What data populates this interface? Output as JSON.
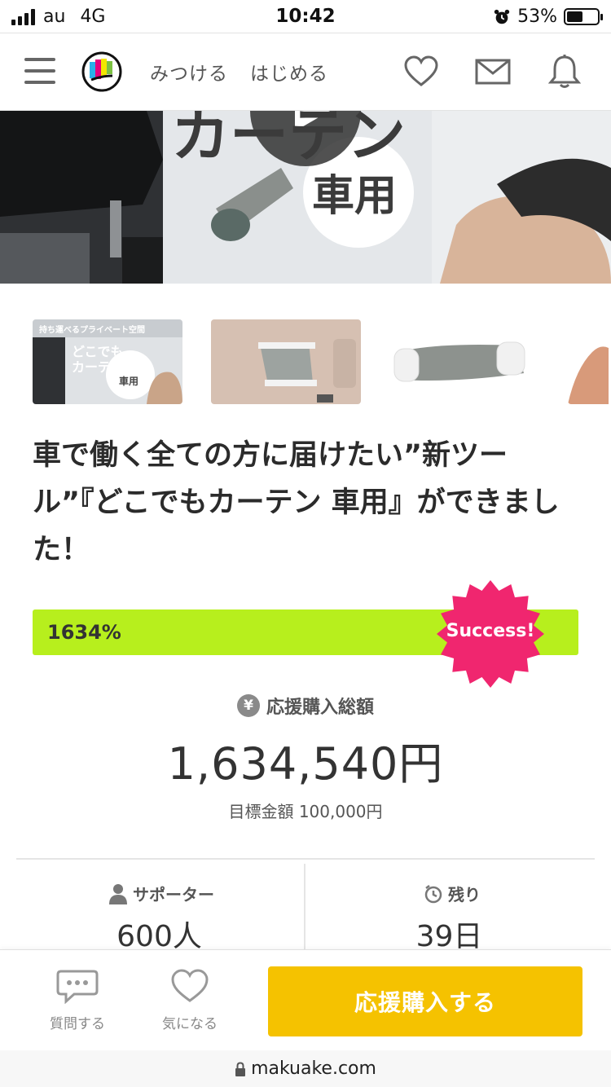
{
  "status_bar": {
    "carrier": "au",
    "network": "4G",
    "time": "10:42",
    "battery": "53%",
    "battery_level": 0.53
  },
  "header": {
    "nav": [
      "みつける",
      "はじめる"
    ],
    "icons": [
      "heart-icon",
      "mail-icon",
      "bell-icon"
    ]
  },
  "hero": {
    "headline": "カーテン",
    "sub": "車用"
  },
  "thumbnails": [
    {
      "caption_top": "持ち運べるプライベート空間",
      "line1": "どこでも",
      "line2": "カーテン",
      "line3": "車用"
    },
    {},
    {},
    {}
  ],
  "project": {
    "title": "車で働く全ての方に届けたい”新ツール”『どこでもカーテン 車用』ができました！",
    "progress_percent_text": "1634%",
    "progress_value": 1634,
    "status_badge": "Success!",
    "amount_label": "応援購入総額",
    "amount_icon": "¥",
    "amount": "1,634,540円",
    "goal": "目標金額 100,000円"
  },
  "stats": {
    "supporters_label": "サポーター",
    "supporters_value": "600人",
    "remaining_label": "残り",
    "remaining_value": "39日"
  },
  "actions": {
    "ask": "質問する",
    "favorite": "気になる",
    "buy": "応援購入する"
  },
  "browser": {
    "url": "makuake.com"
  },
  "colors": {
    "progress": "#b7ef1d",
    "success_badge": "#f0266f",
    "buy_button": "#f5c200"
  }
}
